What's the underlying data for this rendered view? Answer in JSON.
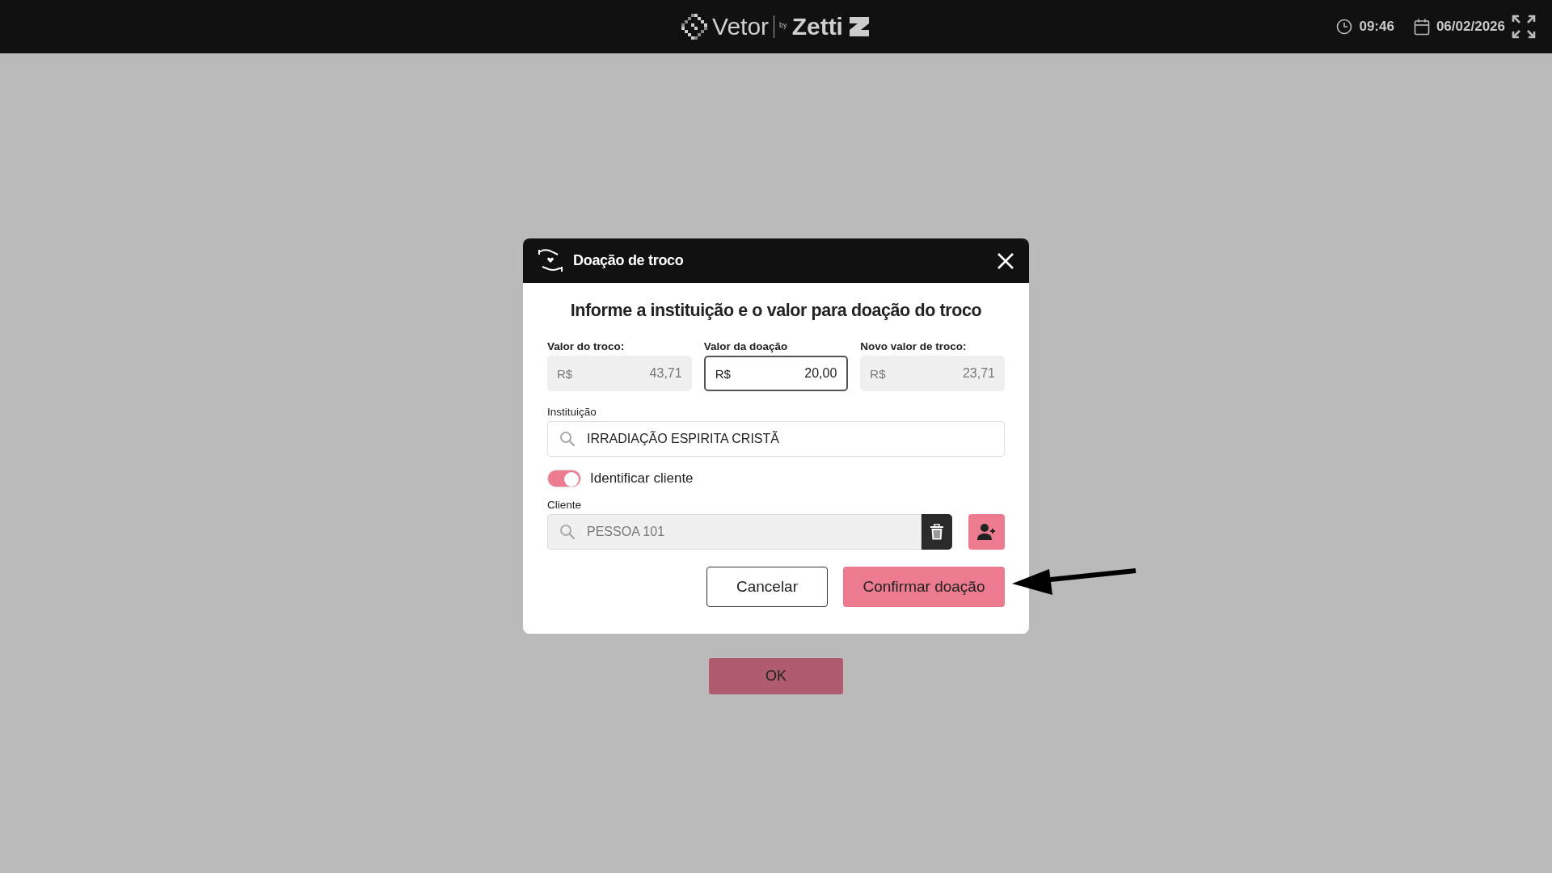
{
  "header": {
    "logo": {
      "brand": "Vetor",
      "by": "by",
      "partner": "Zetti"
    },
    "time": "09:46",
    "date": "06/02/2026"
  },
  "dialog": {
    "title": "Doação de troco",
    "heading": "Informe a instituição e o valor para doação do troco",
    "amounts": [
      {
        "label": "Valor do troco:",
        "currency": "R$",
        "value": "43,71",
        "kind": "readonly"
      },
      {
        "label": "Valor da doação",
        "currency": "R$",
        "value": "20,00",
        "kind": "input"
      },
      {
        "label": "Novo valor de troco:",
        "currency": "R$",
        "value": "23,71",
        "kind": "readonly"
      }
    ],
    "institution": {
      "label": "Instituição",
      "value": "IRRADIAÇÃO ESPIRITA CRISTÃ"
    },
    "identify_client": {
      "label": "Identificar cliente",
      "on": true
    },
    "client": {
      "label": "Cliente",
      "value": "PESSOA 101"
    },
    "buttons": [
      {
        "label": "Cancelar",
        "kind": "secondary"
      },
      {
        "label": "Confirmar doação",
        "kind": "primary"
      }
    ]
  },
  "ok_button": {
    "label": "OK"
  }
}
